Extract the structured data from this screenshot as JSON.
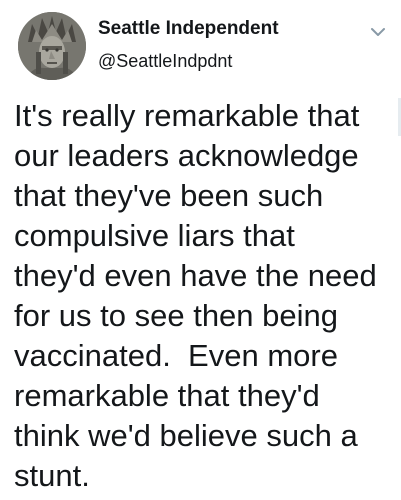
{
  "user": {
    "display_name": "Seattle Independent",
    "handle": "@SeattleIndpdnt",
    "avatar_icon": "statue-portrait-avatar"
  },
  "menu": {
    "icon": "chevron-down-icon"
  },
  "tweet": {
    "lines": [
      "It's really remarkable that",
      "our leaders acknowledge",
      "that they've been such",
      "compulsive liars that",
      "they'd even have the need",
      "for us to see then being",
      "vaccinated.  Even more",
      "remarkable that they'd",
      "think we'd believe such a",
      "stunt."
    ]
  },
  "colors": {
    "text": "#14171a",
    "caret": "#8899a6",
    "avatar_bg": "#6b6b66"
  }
}
